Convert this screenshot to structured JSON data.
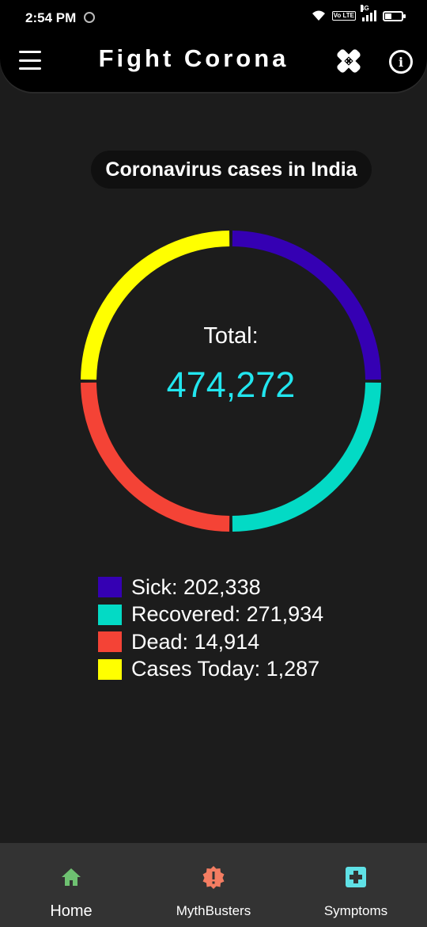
{
  "status_bar": {
    "time": "2:54 PM",
    "volte": "Vo LTE",
    "network": "4G"
  },
  "header": {
    "title": "Fight Corona",
    "menu_icon": "hamburger-menu-icon",
    "virus_icon": "bandage-icon",
    "info_icon": "info-icon",
    "info_glyph": "i"
  },
  "main": {
    "heading": "Coronavirus cases in India",
    "total_label": "Total:",
    "total_value": "474,272"
  },
  "chart_data": {
    "type": "pie",
    "title": "Coronavirus cases in India",
    "center_label": "Total:",
    "center_value": 474272,
    "slices": [
      {
        "name": "Sick",
        "value": 202338,
        "color": "#3500b3"
      },
      {
        "name": "Recovered",
        "value": 271934,
        "color": "#03dac5"
      },
      {
        "name": "Dead",
        "value": 14914,
        "color": "#f44336"
      },
      {
        "name": "Cases Today",
        "value": 1287,
        "color": "#ffff00"
      }
    ],
    "legend_position": "bottom"
  },
  "legend": [
    {
      "text": "Sick: 202,338",
      "color": "#3500b3"
    },
    {
      "text": "Recovered: 271,934",
      "color": "#03dac5"
    },
    {
      "text": "Dead: 14,914",
      "color": "#f44336"
    },
    {
      "text": "Cases Today: 1,287",
      "color": "#ffff00"
    }
  ],
  "bottom_nav": {
    "items": [
      {
        "label": "Home",
        "icon": "home-icon",
        "color": "#6ec171"
      },
      {
        "label": "MythBusters",
        "icon": "alert-badge-icon",
        "color": "#f47d62"
      },
      {
        "label": "Symptoms",
        "icon": "medical-plus-icon",
        "color": "#5fe1e6"
      }
    ]
  }
}
